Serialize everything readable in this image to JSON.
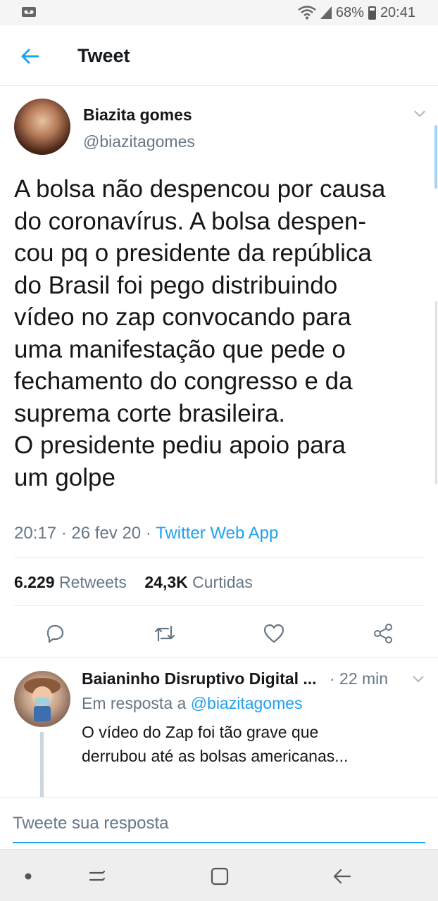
{
  "status_bar": {
    "battery": "68%",
    "time": "20:41",
    "icons": [
      "voicemail-icon",
      "wifi-icon",
      "signal-icon",
      "battery-icon"
    ]
  },
  "header": {
    "title": "Tweet",
    "back_icon": "arrow-left-icon"
  },
  "tweet": {
    "author_name": "Biazita gomes",
    "author_handle": "@biazitagomes",
    "text": "A bolsa não despencou por causa\ndo coronavírus. A bolsa despen-\ncou pq o presidente da república\ndo Brasil foi pego distribuindo\nvídeo no zap convocando para\numa manifestação que pede o\nfechamento do congresso e da\nsuprema corte brasileira.\nO presidente pediu apoio para\num golpe",
    "time": "20:17",
    "date": "26 fev 20",
    "source": "Twitter Web App",
    "retweets_count": "6.229",
    "retweets_label": "Retweets",
    "likes_count": "24,3K",
    "likes_label": "Curtidas"
  },
  "actions": [
    "reply-icon",
    "retweet-icon",
    "like-icon",
    "share-icon"
  ],
  "reply": {
    "author_name": "Baianinho Disruptivo Digital ...",
    "time": "· 22 min",
    "replying_prefix": "Em resposta a",
    "replying_to": "@biazitagomes",
    "text": "O vídeo do Zap foi tão grave que\nderrubou até as bolsas americanas..."
  },
  "compose": {
    "placeholder": "Tweete sua resposta"
  },
  "nav_bar": [
    "dot-icon",
    "recent-apps-icon",
    "home-icon",
    "back-icon"
  ],
  "colors": {
    "accent": "#1da1f2",
    "secondary_text": "#657786",
    "primary_text": "#14171a"
  }
}
